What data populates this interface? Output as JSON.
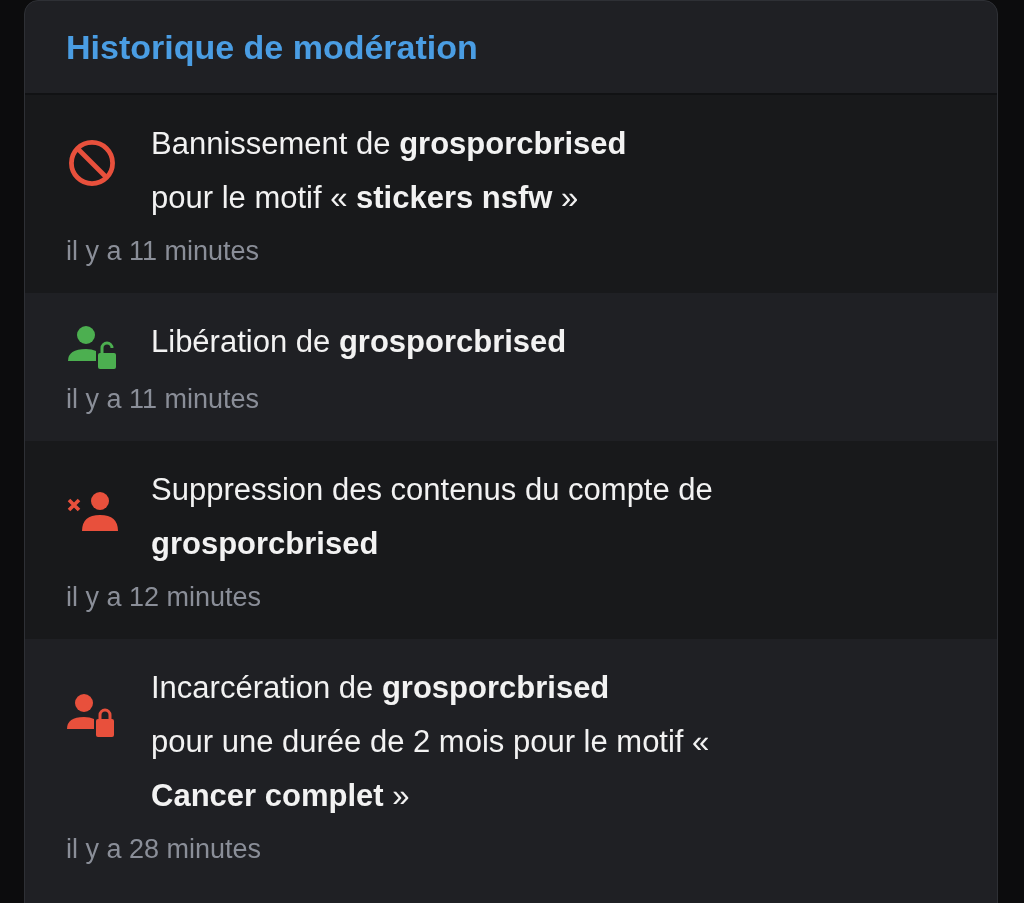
{
  "panel": {
    "title": "Historique de modération"
  },
  "entries": [
    {
      "kind": "ban",
      "lines": [
        "Bannissement de **grosporcbrised**",
        "pour le motif « **stickers nsfw** »"
      ],
      "time": "il y a 11 minutes"
    },
    {
      "kind": "release",
      "lines": [
        "Libération de **grosporcbrised**"
      ],
      "time": "il y a 11 minutes"
    },
    {
      "kind": "purge",
      "lines": [
        "Suppression des contenus du compte de",
        "**grosporcbrised**"
      ],
      "time": "il y a 12 minutes"
    },
    {
      "kind": "jail",
      "lines": [
        "Incarcération de **grosporcbrised**",
        "pour une durée de 2 mois pour le motif «",
        "**Cancer complet** »"
      ],
      "time": "il y a 28 minutes"
    }
  ]
}
